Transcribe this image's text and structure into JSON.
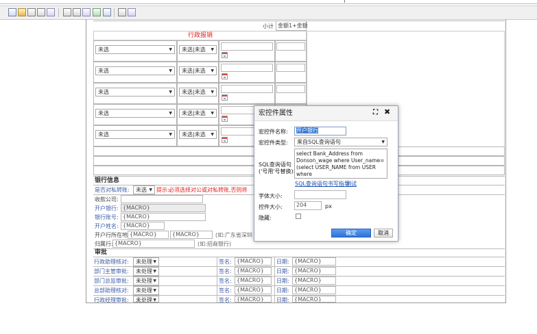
{
  "toolbar": {
    "icons": [
      "new-icon",
      "open-icon",
      "save-icon",
      "print-icon",
      "preview-icon",
      "insert-field-icon",
      "table-icon",
      "layout-icon",
      "chart-icon",
      "image-icon",
      "edit-icon",
      "settings-icon"
    ]
  },
  "header": {
    "subtotal_label": "小计",
    "total_label": "金额1+金额"
  },
  "section_admin": {
    "title": "行政报销"
  },
  "rows": [
    {
      "sel1": "未选",
      "sel2": "未选|未选"
    },
    {
      "sel1": "未选",
      "sel2": "未选|未选"
    },
    {
      "sel1": "未选",
      "sel2": "未选|未选"
    },
    {
      "sel1": "未选",
      "sel2": "未选|未选"
    },
    {
      "sel1": "未选",
      "sel2": "未选|未选"
    }
  ],
  "bank": {
    "title": "银行信息",
    "private_label": "是否对私转账:",
    "private_value": "未选",
    "hint_prefix": "提示:",
    "hint_text": "必须选择对公或对私转账,否则将",
    "payee_label": "收款公司:",
    "bank_label": "开户银行:",
    "bank_value": "{MACRO}",
    "account_label": "银行账号:",
    "account_value": "{MACRO}",
    "holder_label": "开户姓名:",
    "holder_value": "{MACRO}",
    "location_label": "开户行所在地:",
    "location_value1": "{MACRO}",
    "location_value2": "{MACRO}",
    "location_hint": "(如:广东省深圳",
    "branch_label": "归属行:",
    "branch_value": "{MACRO}",
    "branch_hint": "(如:招商银行)"
  },
  "approval": {
    "title": "审批",
    "rows": [
      {
        "role": "行政助理核对:",
        "status": "未处理",
        "sign_label": "签名:",
        "sign_value": "{MACRO}",
        "date_label": "日期:",
        "date_value": "{MACRO}"
      },
      {
        "role": "部门主管审批:",
        "status": "未处理",
        "sign_label": "签名:",
        "sign_value": "{MACRO}",
        "date_label": "日期:",
        "date_value": "{MACRO}"
      },
      {
        "role": "部门总监审批:",
        "status": "未处理",
        "sign_label": "签名:",
        "sign_value": "{MACRO}",
        "date_label": "日期:",
        "date_value": "{MACRO}"
      },
      {
        "role": "总部助理核对:",
        "status": "未处理",
        "sign_label": "签名:",
        "sign_value": "{MACRO}",
        "date_label": "日期:",
        "date_value": "{MACRO}"
      },
      {
        "role": "行政经理审批:",
        "status": "未处理",
        "sign_label": "签名:",
        "sign_value": "{MACRO}",
        "date_label": "日期:",
        "date_value": "{MACRO}"
      }
    ]
  },
  "dialog": {
    "title": "宏控件属性",
    "name_label": "宏控件名称:",
    "name_value": "开户银行",
    "type_label": "宏控件类型:",
    "type_value": "来自SQL查询语句",
    "sql_label": "SQL查询语句",
    "sql_sublabel": "('号用'号替换):",
    "sql_value": "select Bank_Address from Donson_wage where User_name=(select USER_NAME from USER where USER_ID='{SYS_USER_ID}')",
    "sql_help_link": "SQL查询语句书写指导",
    "test_link": "测试",
    "font_size_label": "字体大小:",
    "font_size_value": "",
    "width_label": "控件大小:",
    "width_value": "204",
    "width_unit": "px",
    "hidden_label": "隐藏:",
    "ok_label": "确定",
    "cancel_label": "取消"
  },
  "colors": {
    "accent": "#3a7bd5",
    "hint_red": "#e02020",
    "label_blue": "#3a5ca8"
  }
}
